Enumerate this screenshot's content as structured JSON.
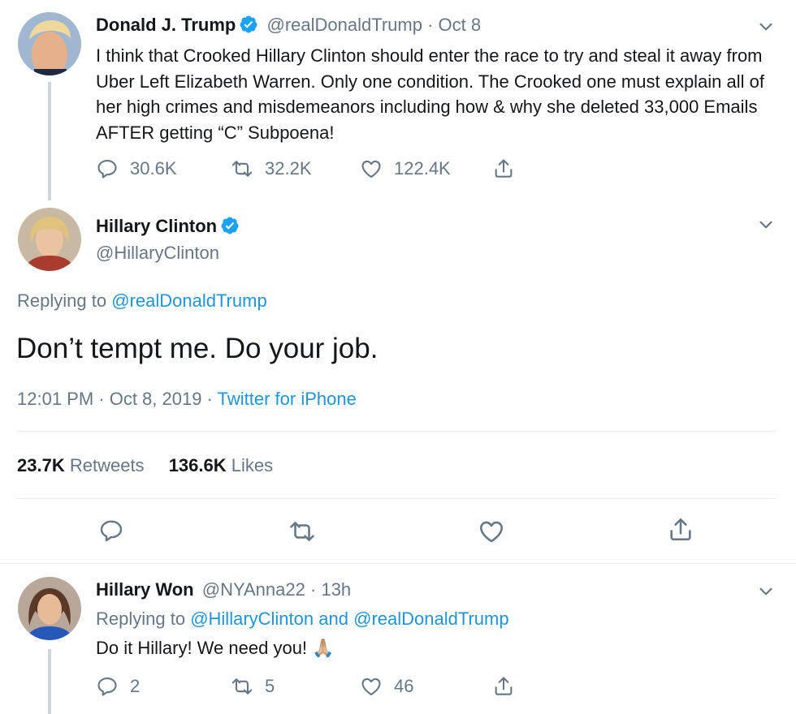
{
  "tweet1": {
    "name": "Donald J. Trump",
    "handle": "@realDonaldTrump",
    "sep": "·",
    "time": "Oct 8",
    "text": "I think that Crooked Hillary Clinton should enter the race to try and steal it away from Uber Left Elizabeth Warren. Only one condition. The Crooked one must explain all of her high crimes and misdemeanors including how & why she deleted 33,000 Emails AFTER getting “C” Subpoena!",
    "replies": "30.6K",
    "retweets": "32.2K",
    "likes": "122.4K"
  },
  "main": {
    "name": "Hillary Clinton",
    "handle": "@HillaryClinton",
    "replying_prefix": "Replying to",
    "replying_to": "@realDonaldTrump",
    "text": "Don’t tempt me. Do your job.",
    "time": "12:01 PM · Oct 8, 2019",
    "sep": "·",
    "source": "Twitter for iPhone",
    "retweets_count": "23.7K",
    "retweets_label": "Retweets",
    "likes_count": "136.6K",
    "likes_label": "Likes"
  },
  "tweet3": {
    "name": "Hillary Won",
    "handle": "@NYAnna22",
    "sep": "·",
    "time": "13h",
    "replying_prefix": "Replying to",
    "replying_to1": "@HillaryClinton",
    "and": "and",
    "replying_to2": "@realDonaldTrump",
    "text": "Do it Hillary! We need you!",
    "emoji": "🙏🏼",
    "replies": "2",
    "retweets": "5",
    "likes": "46"
  },
  "colors": {
    "verified": "#1da1f2",
    "link": "#1b95e0",
    "muted": "#657786",
    "divider": "#e6ecf0",
    "thread_line": "#ccd6dd"
  },
  "icons": [
    "chevron-down-icon",
    "verified-badge-icon",
    "reply-icon",
    "retweet-icon",
    "like-icon",
    "share-icon"
  ]
}
